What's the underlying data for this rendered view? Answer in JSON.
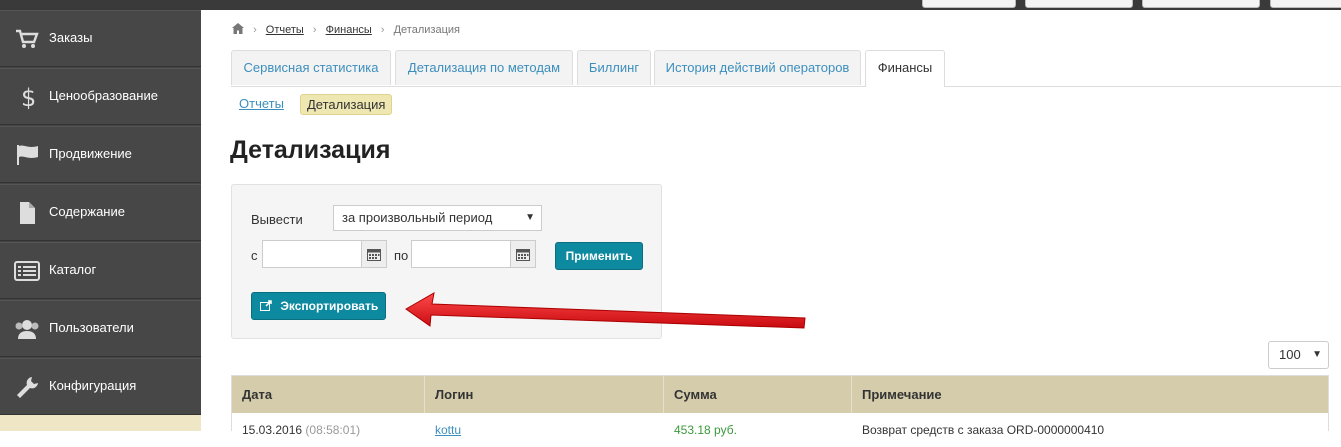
{
  "sidebar": {
    "items": [
      {
        "label": "Заказы",
        "icon": "cart-icon"
      },
      {
        "label": "Ценообразование",
        "icon": "dollar-icon"
      },
      {
        "label": "Продвижение",
        "icon": "flag-icon"
      },
      {
        "label": "Содержание",
        "icon": "document-icon"
      },
      {
        "label": "Каталог",
        "icon": "list-icon"
      },
      {
        "label": "Пользователи",
        "icon": "users-icon"
      },
      {
        "label": "Конфигурация",
        "icon": "wrench-icon"
      }
    ]
  },
  "breadcrumb": {
    "items": [
      "Отчеты",
      "Финансы",
      "Детализация"
    ]
  },
  "tabs": [
    {
      "label": "Сервисная статистика"
    },
    {
      "label": "Детализация по методам"
    },
    {
      "label": "Биллинг"
    },
    {
      "label": "История действий операторов"
    },
    {
      "label": "Финансы",
      "active": true
    }
  ],
  "subnav": {
    "reports": "Отчеты",
    "details": "Детализация"
  },
  "page_title": "Детализация",
  "filter": {
    "output_label": "Вывести",
    "period_value": "за произвольный период",
    "from_label": "с",
    "to_label": "по",
    "from_value": "",
    "to_value": "",
    "apply_label": "Применить",
    "export_label": "Экспортировать"
  },
  "per_page": "100",
  "table": {
    "headers": [
      "Дата",
      "Логин",
      "Сумма",
      "Примечание"
    ],
    "rows": [
      {
        "date": "15.03.2016",
        "time": "(08:58:01)",
        "login": "kottu",
        "amount": "453.18 руб.",
        "note": "Возврат средств с заказа ORD-0000000410"
      }
    ]
  },
  "colors": {
    "accent": "#0e8aa0",
    "sidebar": "#474747",
    "table_header": "#d4ccab",
    "arrow": "#e8141a"
  }
}
